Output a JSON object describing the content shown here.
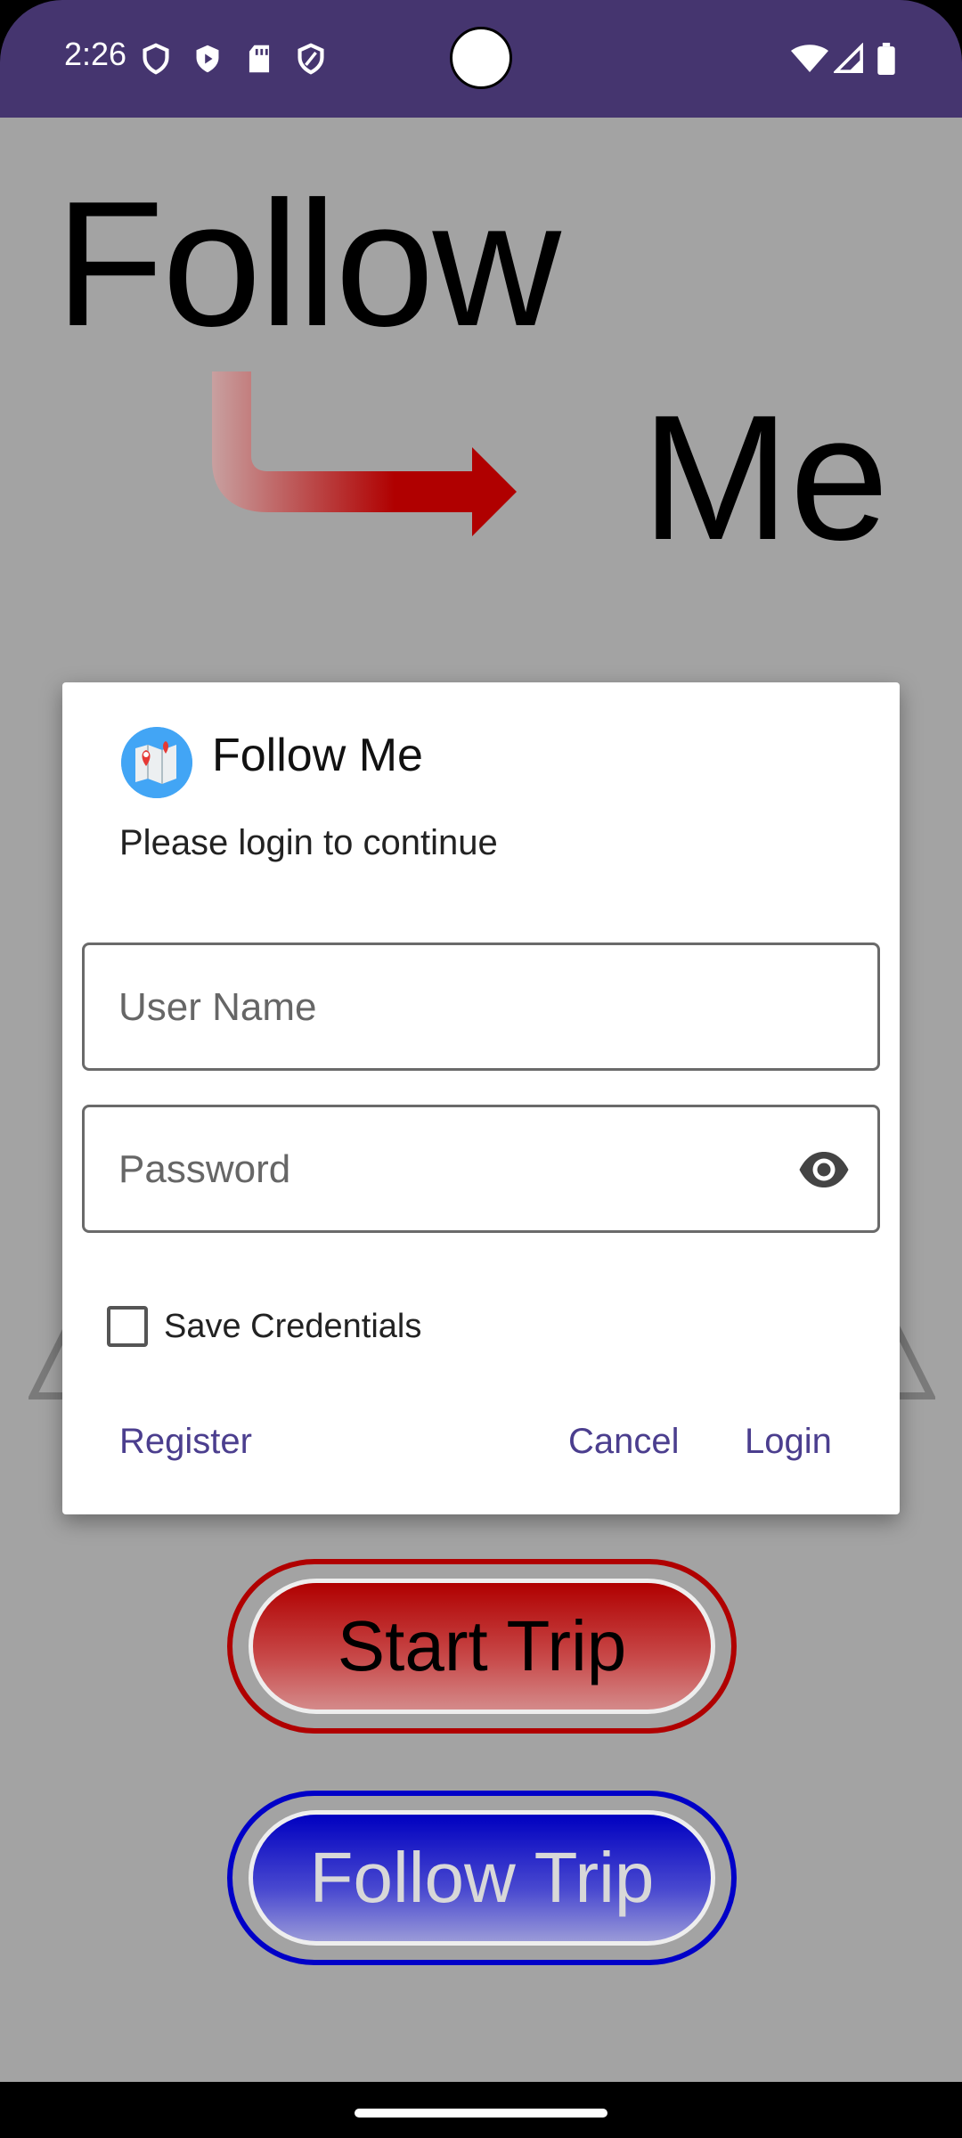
{
  "status_bar": {
    "time": "2:26",
    "bg_color": "#45356f"
  },
  "logo": {
    "word1": "Follow",
    "word2": "Me",
    "arrow_color": "#b00000"
  },
  "dialog": {
    "title": "Follow Me",
    "message": "Please login to continue",
    "username_placeholder": "User Name",
    "password_placeholder": "Password",
    "save_credentials_label": "Save Credentials",
    "save_credentials_checked": false,
    "register_label": "Register",
    "cancel_label": "Cancel",
    "login_label": "Login",
    "action_color": "#4b3e8e"
  },
  "buttons": {
    "start_trip": "Start Trip",
    "follow_trip": "Follow Trip",
    "start_color": "#b00000",
    "follow_color": "#0000c8"
  },
  "colors": {
    "background": "#a3a3a3"
  }
}
